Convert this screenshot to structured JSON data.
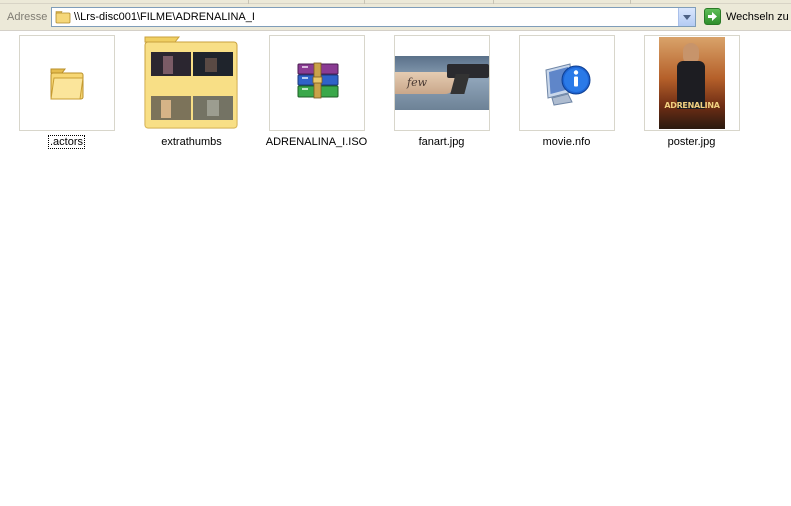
{
  "address_bar": {
    "label": "Adresse",
    "path": "\\\\Lrs-disc001\\FILME\\ADRENALINA_I",
    "go_label": "Wechseln zu"
  },
  "files": [
    {
      "name": ".actors",
      "type": "folder",
      "icon": "folder-icon"
    },
    {
      "name": "extrathumbs",
      "type": "folder",
      "icon": "thumbnail-folder-icon"
    },
    {
      "name": "ADRENALINA_I.ISO",
      "type": "archive",
      "icon": "winrar-archive-icon"
    },
    {
      "name": "fanart.jpg",
      "type": "image",
      "icon": "fanart-thumbnail"
    },
    {
      "name": "movie.nfo",
      "type": "info",
      "icon": "info-file-icon"
    },
    {
      "name": "poster.jpg",
      "type": "image",
      "icon": "poster-thumbnail"
    }
  ],
  "poster_text": "ADRENALINA",
  "fanart_text": "few"
}
